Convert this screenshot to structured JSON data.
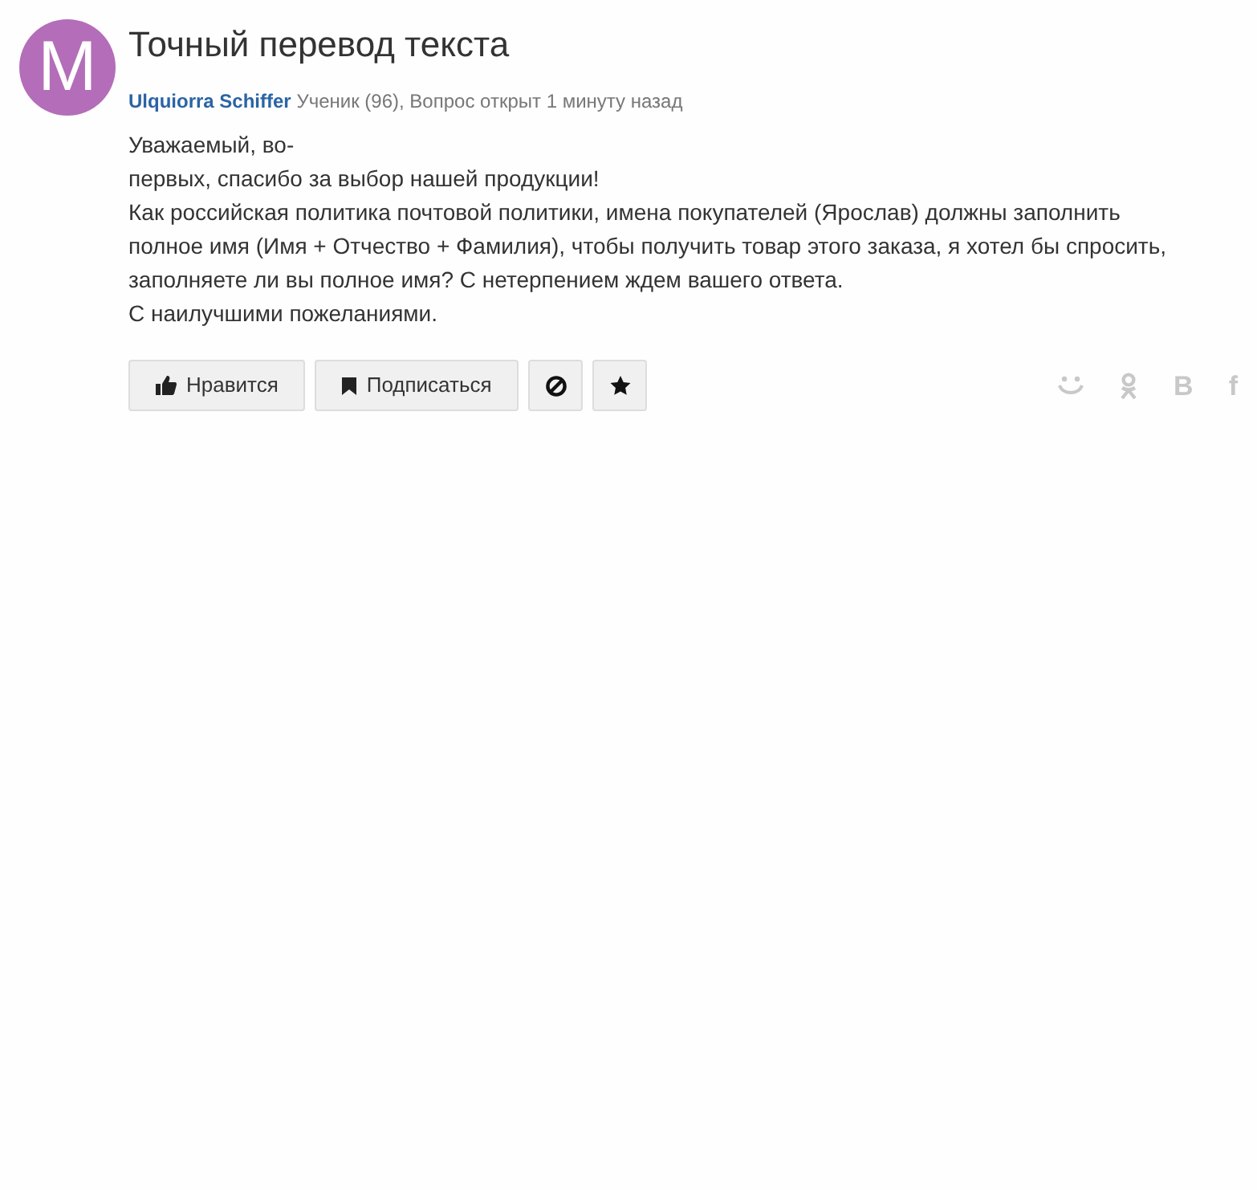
{
  "avatar": {
    "letter": "M"
  },
  "title": "Точный перевод текста",
  "author": {
    "name": "Ulquiorra Schiffer",
    "info": "Ученик (96), Вопрос открыт 1 минуту назад"
  },
  "body_lines": [
    "Уважаемый, во-",
    "первых, спасибо за выбор нашей продукции!",
    "Как российская политика почтовой политики, имена покупателей (Ярослав) должны заполнить",
    "полное имя (Имя + Отчество + Фамилия), чтобы получить товар этого заказа, я хотел бы спросить,",
    "заполняете ли вы полное имя? С нетерпением ждем вашего ответа.",
    "С наилучшими пожеланиями."
  ],
  "actions": [
    {
      "kind": "like",
      "label": "Нравится"
    },
    {
      "kind": "subscribe",
      "label": "Подписаться"
    },
    {
      "kind": "block"
    },
    {
      "kind": "star"
    }
  ],
  "share": [
    {
      "kind": "smile"
    },
    {
      "kind": "ok"
    },
    {
      "kind": "letter",
      "glyph": "B"
    },
    {
      "kind": "letter",
      "glyph": "f"
    }
  ]
}
